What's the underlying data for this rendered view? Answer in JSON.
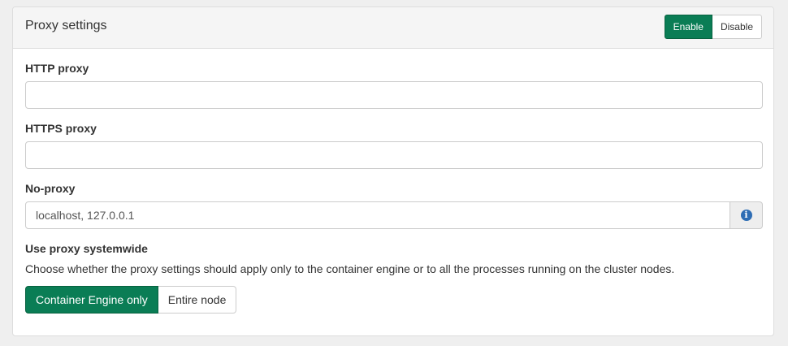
{
  "panel": {
    "title": "Proxy settings",
    "toggle": {
      "enable_label": "Enable",
      "disable_label": "Disable",
      "active": "enable"
    }
  },
  "fields": {
    "http_proxy": {
      "label": "HTTP proxy",
      "value": "",
      "placeholder": ""
    },
    "https_proxy": {
      "label": "HTTPS proxy",
      "value": "",
      "placeholder": ""
    },
    "no_proxy": {
      "label": "No-proxy",
      "value": "localhost, 127.0.0.1",
      "addon_icon": "info-icon"
    }
  },
  "systemwide": {
    "label": "Use proxy systemwide",
    "help": "Choose whether the proxy settings should apply only to the container engine or to all the processes running on the cluster nodes.",
    "options": [
      "Container Engine only",
      "Entire node"
    ],
    "selected": "Container Engine only"
  },
  "colors": {
    "accent": "#0a7d55",
    "info": "#2e6db4",
    "page_bg": "#efefef"
  }
}
